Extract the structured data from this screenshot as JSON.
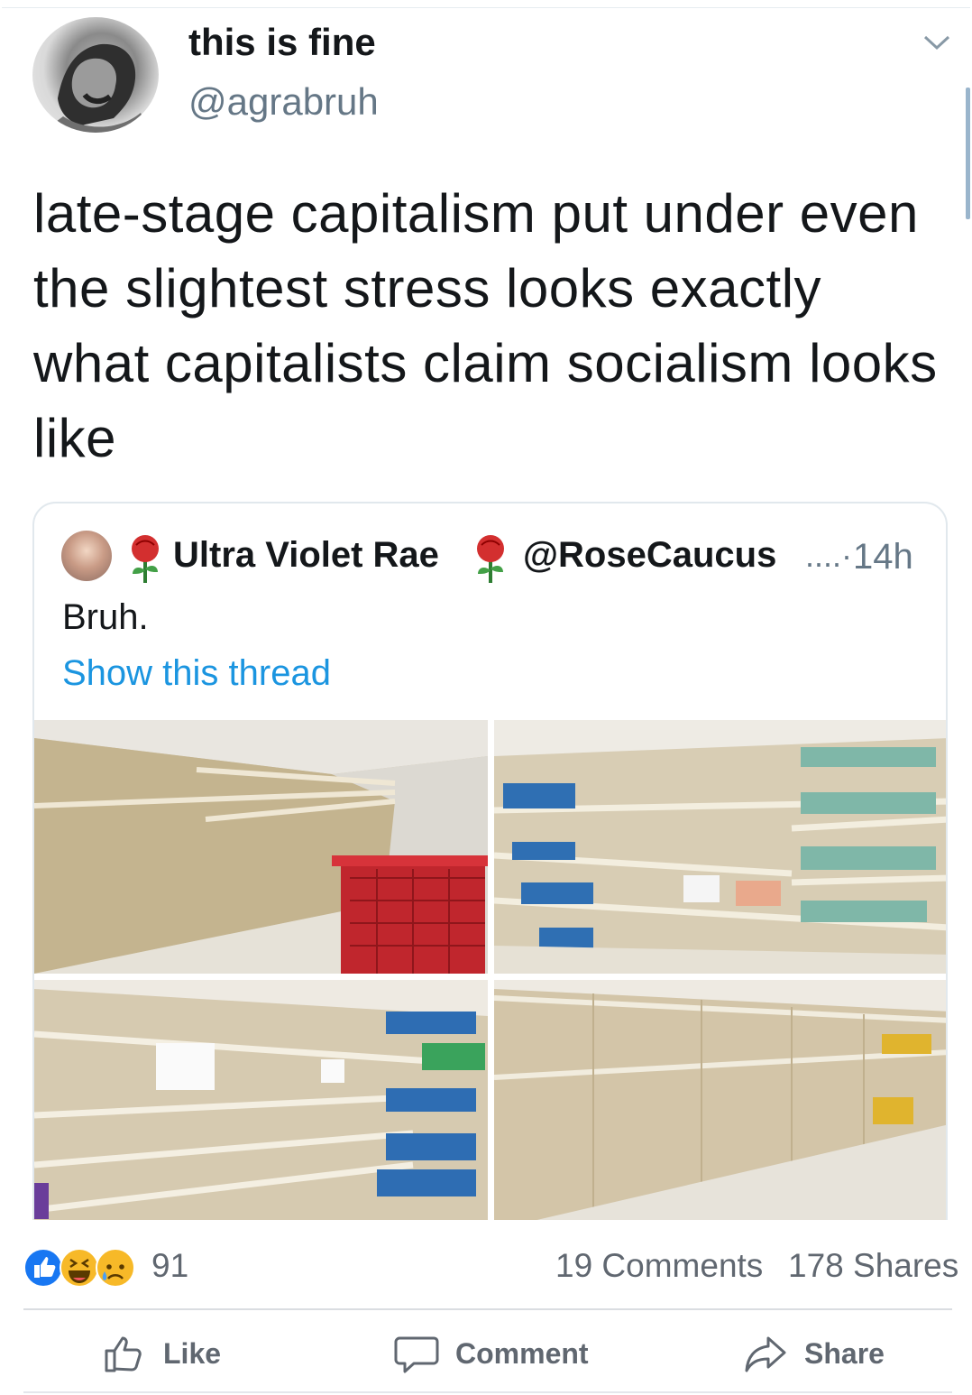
{
  "tweet": {
    "display_name": "this is fine",
    "handle": "@agrabruh",
    "text": "late-stage capitalism put under even the slightest stress looks exactly what capitalists claim socialism looks like",
    "icons": [
      "avatar",
      "chevron-down-icon"
    ]
  },
  "quoted": {
    "display_name": "Ultra Violet Rae",
    "handle": "@RoseCaucus",
    "dots": "....·",
    "time": "14h",
    "text": "Bruh.",
    "show_thread": "Show this thread",
    "link_color": "#1b95e0",
    "icons": [
      "rose-icon",
      "rose-icon"
    ]
  },
  "facebook": {
    "reaction_count": "91",
    "comments": "19 Comments",
    "shares": "178 Shares",
    "actions": {
      "like": "Like",
      "comment": "Comment",
      "share": "Share"
    },
    "reaction_icons": [
      "like-reaction-icon",
      "haha-reaction-icon",
      "sad-reaction-icon"
    ],
    "colors": {
      "like_blue": "#1877f2",
      "reaction_yellow": "#f7b928",
      "muted_text": "#606770"
    }
  }
}
